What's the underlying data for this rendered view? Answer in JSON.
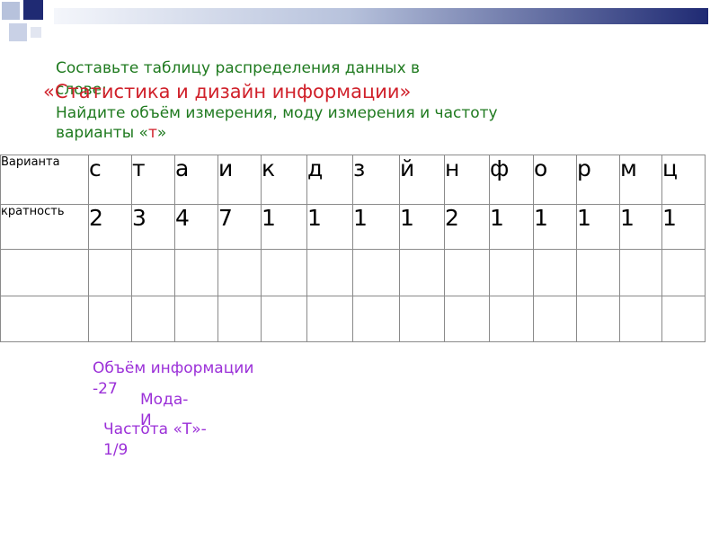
{
  "task": {
    "line1": "Составьте таблицу распределения данных в",
    "line2": "слове:",
    "title": "«Статистика и  дизайн информации»",
    "line3": "Найдите объём измерения, моду измерения и частоту",
    "line4_prefix": "варианты «",
    "line4_letter": "т",
    "line4_suffix": "»"
  },
  "table": {
    "row_labels": [
      "Варианта",
      "кратность"
    ],
    "variants": [
      "с",
      "т",
      "а",
      "и",
      "к",
      "д",
      "з",
      "й",
      "н",
      "ф",
      "о",
      "р",
      "м",
      "ц"
    ],
    "multiplicity": [
      "2",
      "3",
      "4",
      "7",
      "1",
      "1",
      "1",
      "1",
      "2",
      "1",
      "1",
      "1",
      "1",
      "1"
    ]
  },
  "answers": {
    "volume_line1": "Объём информации",
    "volume_line2": "-27",
    "mode_line1": "Мода-",
    "mode_line2": "И",
    "freq_line1": "Частота «Т»-",
    "freq_line2": "1/9"
  },
  "colors": {
    "task_text": "#1f7a1f",
    "title_text": "#d0202a",
    "answer_text": "#9b30d8",
    "bar_dark": "#1f2a73"
  }
}
